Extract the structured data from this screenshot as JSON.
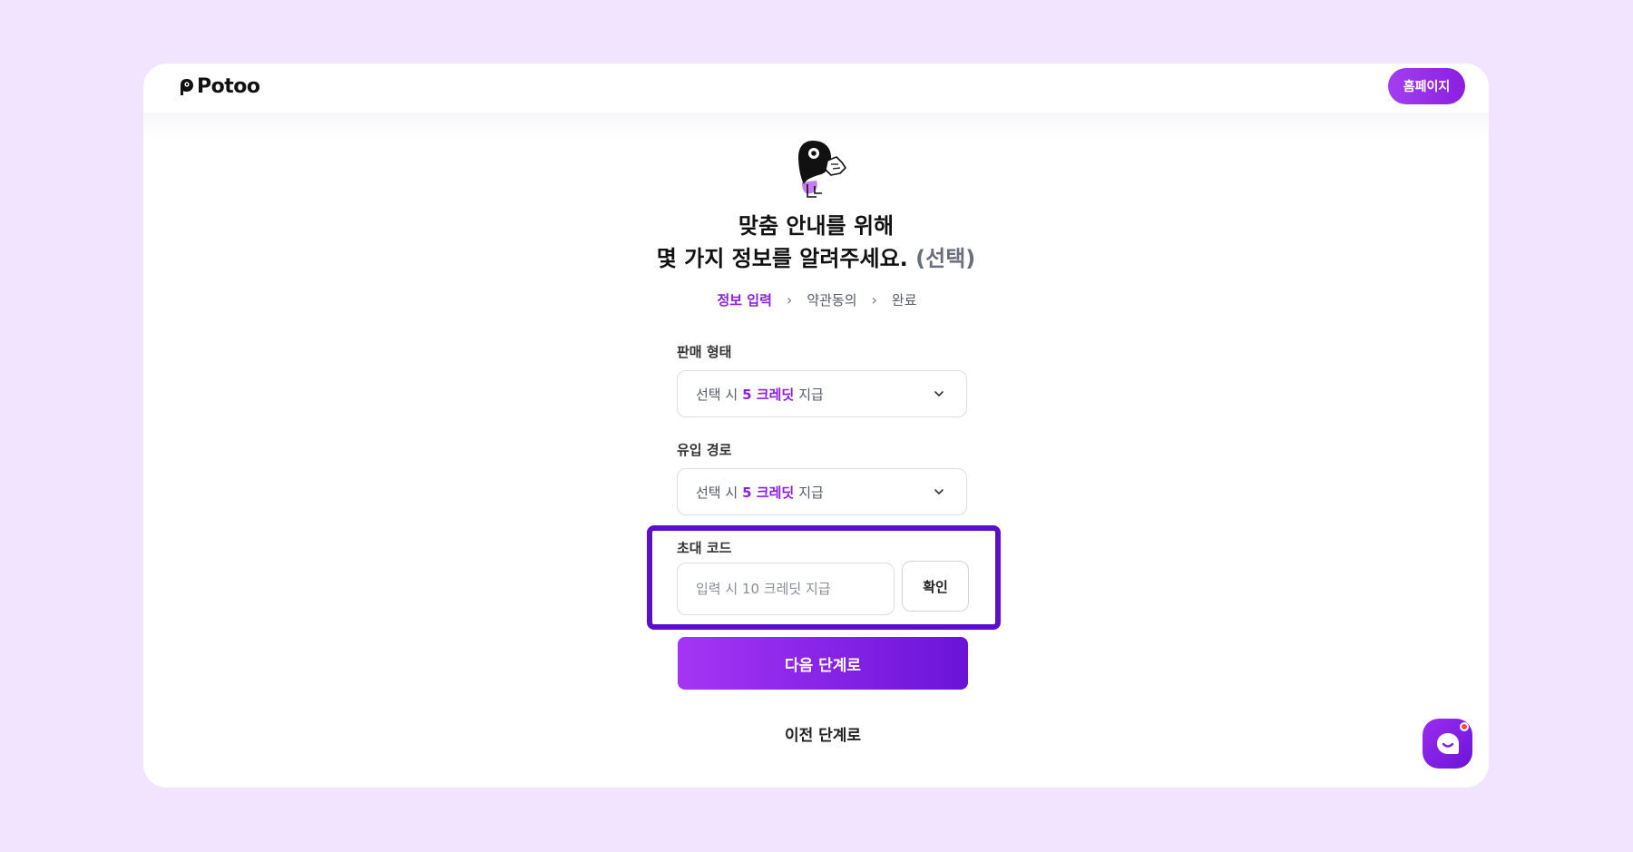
{
  "header": {
    "logo_text": "Potoo",
    "home_button_label": "홈페이지"
  },
  "heading": {
    "line1": "맞춤 안내를 위해",
    "line2": "몇 가지 정보를 알려주세요.",
    "optional": "(선택)"
  },
  "steps": [
    {
      "label": "정보 입력",
      "active": true
    },
    {
      "label": "약관동의",
      "active": false
    },
    {
      "label": "완료",
      "active": false
    }
  ],
  "form": {
    "sales_type": {
      "label": "판매 형태",
      "prefix": "선택 시",
      "credit": "5 크레딧",
      "suffix": "지급"
    },
    "inflow_path": {
      "label": "유입 경로",
      "prefix": "선택 시",
      "credit": "5 크레딧",
      "suffix": "지급"
    },
    "invite_code": {
      "label": "초대 코드",
      "placeholder": "입력 시 10 크레딧 지급",
      "value": "",
      "confirm_label": "확인"
    },
    "next_label": "다음 단계로",
    "prev_label": "이전 단계로"
  },
  "colors": {
    "accent": "#8a1fe0",
    "background": "#f2e3ff",
    "highlight_border": "#5b0fc8",
    "notification": "#ff4b4b"
  },
  "icons": {
    "logo": "potoo-bird-logo-icon",
    "mascot": "potoo-mascot-icon",
    "step_separator": "chevron-right-icon",
    "select_caret": "chevron-down-icon",
    "chat": "chat-bubble-icon"
  }
}
